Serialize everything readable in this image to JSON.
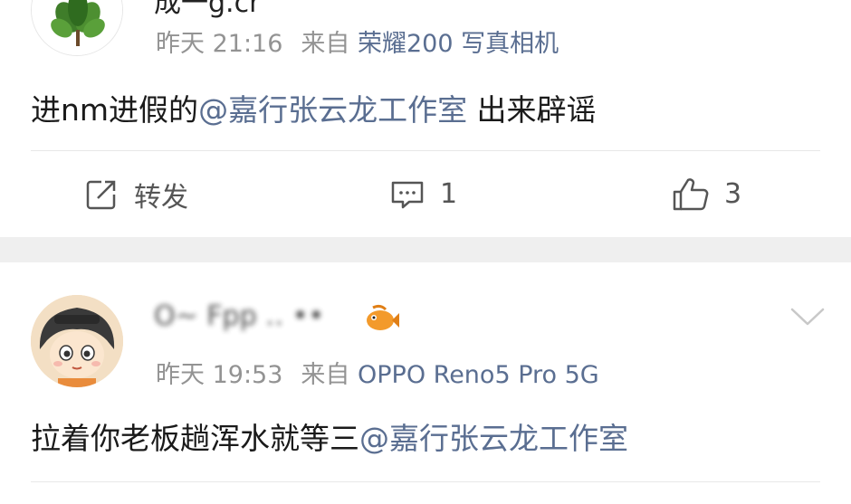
{
  "posts": [
    {
      "username": "成一g.cr",
      "time": "昨天 21:16",
      "source_prefix": "来自",
      "device": "荣耀200 写真相机",
      "content_before": "进nm进假的",
      "mention": "@嘉行张云龙工作室",
      "content_after": " 出来辟谣",
      "actions": {
        "repost_label": "转发",
        "comment_count": "1",
        "like_count": "3"
      }
    },
    {
      "username": "O~ Fpp ‥ ••",
      "time": "昨天 19:53",
      "source_prefix": "来自",
      "device": "OPPO Reno5 Pro 5G",
      "content_before": "拉着你老板趟浑水就等三",
      "mention": "@嘉行张云龙工作室"
    }
  ],
  "colors": {
    "link": "#5a6e91",
    "meta": "#939393",
    "separator": "#efefef"
  },
  "icons": [
    "plant-avatar",
    "repost-icon",
    "comment-icon",
    "like-icon",
    "cartoon-avatar",
    "fish-emoji-icon",
    "chevron-down-icon"
  ]
}
